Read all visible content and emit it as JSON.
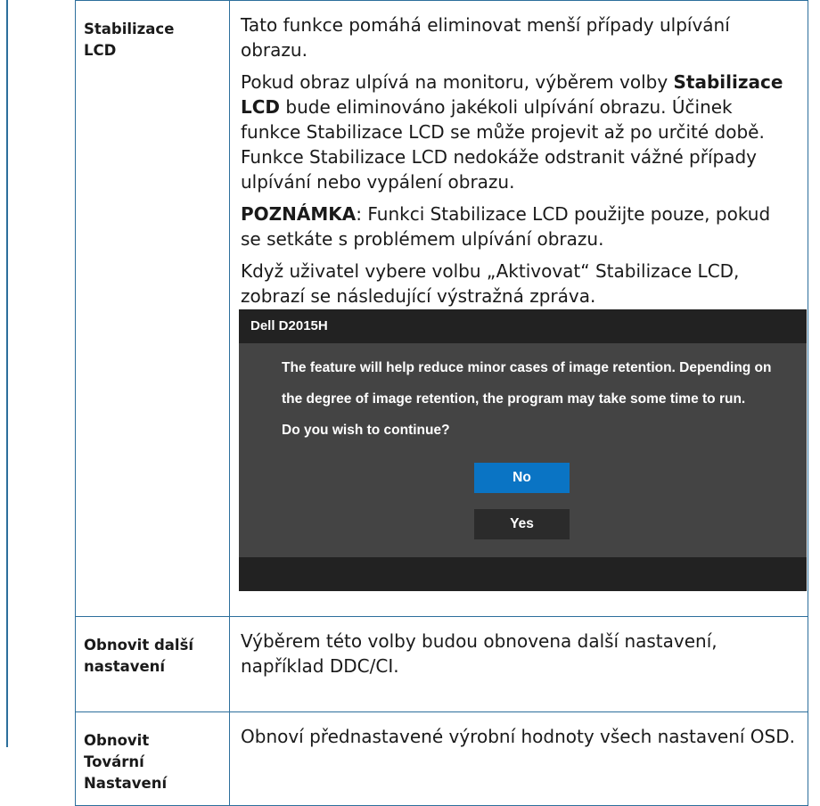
{
  "rows": [
    {
      "label_line1": "Stabilizace",
      "label_line2": "LCD",
      "para1": "Tato funkce pomáhá eliminovat menší případy ulpívání obrazu.",
      "para2_before": "Pokud obraz ulpívá na monitoru, výběrem volby ",
      "para2_bold": "Stabilizace LCD",
      "para2_after": " bude eliminováno jakékoli ulpívání obrazu. Účinek funkce Stabilizace LCD se může projevit až po určité době. Funkce Stabilizace LCD nedokáže odstranit vážné případy ulpívání nebo vypálení obrazu.",
      "note_bold": "POZNÁMKA",
      "note_text": ": Funkci Stabilizace LCD použijte pouze, pokud se setkáte s problémem ulpívání obrazu.",
      "para4": "Když uživatel vybere volbu „Aktivovat“ Stabilizace LCD, zobrazí se následující výstražná zpráva."
    },
    {
      "label_line1": "Obnovit další",
      "label_line2": "nastavení",
      "text": "Výběrem této volby budou obnovena další nastavení, například DDC/CI."
    },
    {
      "label_line1": "Obnovit",
      "label_line2": "Tovární",
      "label_line3": "Nastavení",
      "text": "Obnoví přednastavené výrobní hodnoty všech nastavení OSD."
    }
  ],
  "dialog": {
    "title": "Dell D2015H",
    "line1": "The feature will help reduce minor cases of image retention. Depending on",
    "line2": "the degree of image retention, the program may take some time to run.",
    "line3": "Do you wish to continue?",
    "no_label": "No",
    "yes_label": "Yes"
  },
  "colors": {
    "border": "#2d6f9c",
    "dialog_bg": "#444444",
    "dialog_bar": "#222222",
    "no_button": "#0a74c4",
    "yes_button": "#2b2b2b"
  }
}
